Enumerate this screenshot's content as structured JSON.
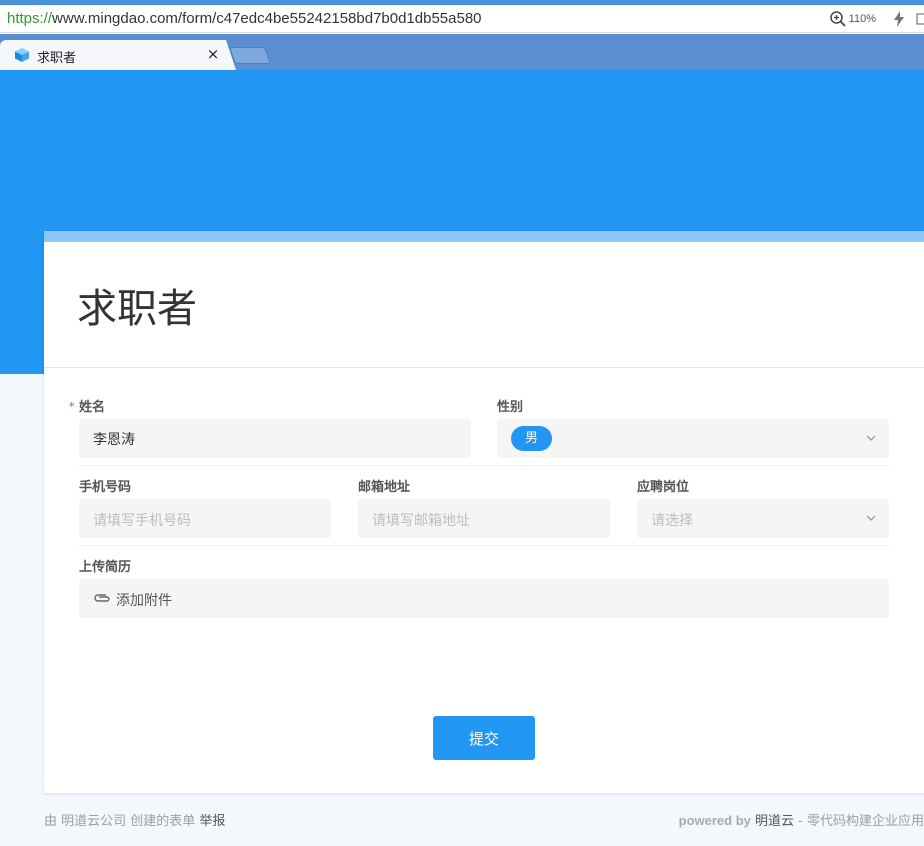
{
  "browser": {
    "url_scheme": "https://",
    "url_rest": "www.mingdao.com/form/c47edc4be55242158bd7b0d1db55a580",
    "zoom": "110%",
    "tab_title": "求职者",
    "tab_close": "×"
  },
  "form": {
    "title": "求职者",
    "required_mark": "*",
    "fields": {
      "name": {
        "label": "姓名",
        "value": "李恩涛"
      },
      "gender": {
        "label": "性别",
        "value": "男"
      },
      "phone": {
        "label": "手机号码",
        "placeholder": "请填写手机号码"
      },
      "email": {
        "label": "邮箱地址",
        "placeholder": "请填写邮箱地址"
      },
      "position": {
        "label": "应聘岗位",
        "placeholder": "请选择"
      },
      "resume": {
        "label": "上传简历",
        "action": "添加附件"
      }
    },
    "submit_label": "提交"
  },
  "footer": {
    "by": "由 明道云公司 创建的表单",
    "report": "举报",
    "powered": "powered by",
    "brand": "明道云",
    "slogan": " - 零代码构建企业应用"
  },
  "colors": {
    "primary": "#2196f3",
    "header_bg": "#2196f3",
    "card_top": "#8cc7f7",
    "required": "#e53935"
  },
  "icons": [
    "zoom-icon",
    "flash-icon",
    "cube-favicon",
    "chevron-down-icon",
    "paperclip-icon"
  ]
}
